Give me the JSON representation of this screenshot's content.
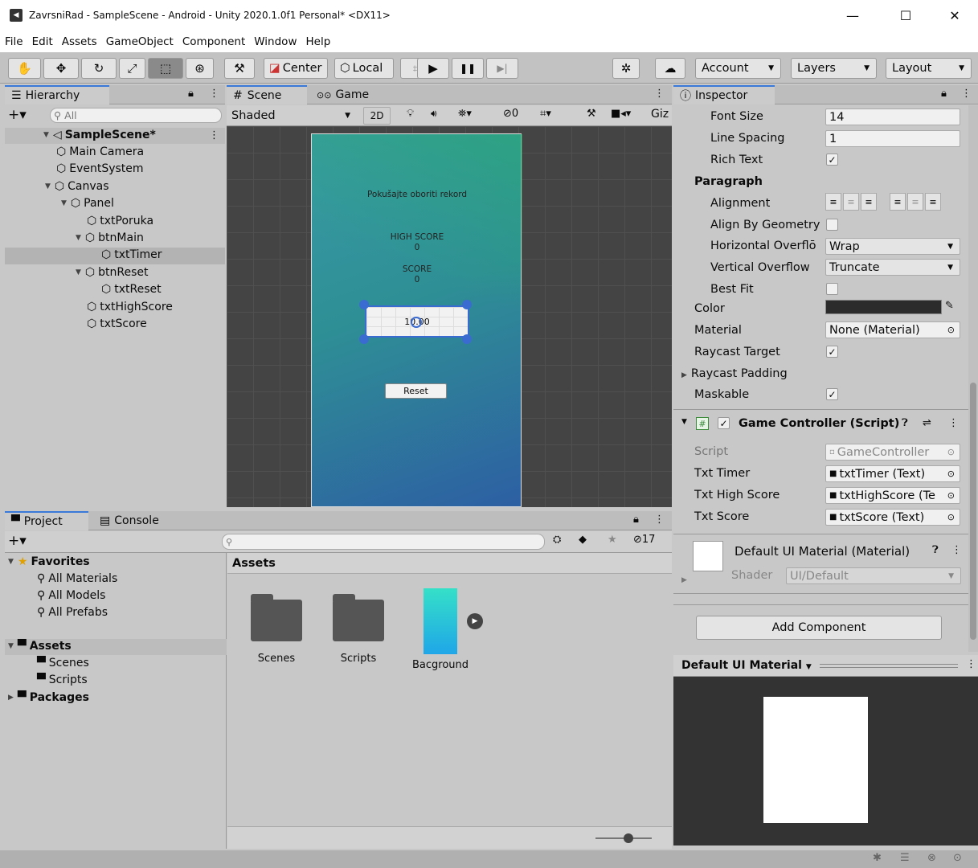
{
  "window": {
    "title": "ZavrsniRad - SampleScene - Android - Unity 2020.1.0f1 Personal* <DX11>",
    "minimize": "—",
    "maximize": "☐",
    "close": "✕"
  },
  "menu": [
    "File",
    "Edit",
    "Assets",
    "GameObject",
    "Component",
    "Window",
    "Help"
  ],
  "toolbar": {
    "center": "Center",
    "local": "Local",
    "account": "Account",
    "layers": "Layers",
    "layout": "Layout"
  },
  "hierarchy": {
    "tab": "Hierarchy",
    "search_placeholder": "All",
    "scene": "SampleScene*",
    "items": [
      {
        "label": "Main Camera",
        "level": 1,
        "expander": ""
      },
      {
        "label": "EventSystem",
        "level": 1,
        "expander": ""
      },
      {
        "label": "Canvas",
        "level": 1,
        "expander": "▼"
      },
      {
        "label": "Panel",
        "level": 2,
        "expander": "▼"
      },
      {
        "label": "txtPoruka",
        "level": 3,
        "expander": ""
      },
      {
        "label": "btnMain",
        "level": 3,
        "expander": "▼"
      },
      {
        "label": "txtTimer",
        "level": 4,
        "expander": "",
        "selected": true
      },
      {
        "label": "btnReset",
        "level": 3,
        "expander": "▼"
      },
      {
        "label": "txtReset",
        "level": 4,
        "expander": ""
      },
      {
        "label": "txtHighScore",
        "level": 3,
        "expander": ""
      },
      {
        "label": "txtScore",
        "level": 3,
        "expander": ""
      }
    ]
  },
  "scene": {
    "tab_scene": "Scene",
    "tab_game": "Game",
    "shading": "Shaded",
    "mode2d": "2D",
    "gizmos": "Giz",
    "hidden_count": "0",
    "game_text": {
      "message": "Pokušajte oboriti rekord",
      "highscore_label": "HIGH SCORE",
      "highscore_value": "0",
      "score_label": "SCORE",
      "score_value": "0",
      "timer": "10.00",
      "reset": "Reset"
    }
  },
  "inspector": {
    "tab": "Inspector",
    "text_props": [
      {
        "label": "Font Size",
        "value": "14"
      },
      {
        "label": "Line Spacing",
        "value": "1"
      }
    ],
    "rich_text": "Rich Text",
    "paragraph": "Paragraph",
    "alignment": "Alignment",
    "align_by_geometry": "Align By Geometry",
    "h_overflow": {
      "label": "Horizontal Overflō",
      "value": "Wrap"
    },
    "v_overflow": {
      "label": "Vertical Overflow",
      "value": "Truncate"
    },
    "best_fit": "Best Fit",
    "color": "Color",
    "color_value": "#2b2b2b",
    "material": "Material",
    "material_value": "None (Material)",
    "raycast_target": "Raycast Target",
    "raycast_padding": "Raycast Padding",
    "maskable": "Maskable",
    "component": {
      "title": "Game Controller (Script)",
      "script_label": "Script",
      "script_value": "GameController",
      "fields": [
        {
          "label": "Txt Timer",
          "value": "txtTimer (Text)"
        },
        {
          "label": "Txt High Score",
          "value": "txtHighScore (Te"
        },
        {
          "label": "Txt Score",
          "value": "txtScore (Text)"
        }
      ]
    },
    "material_block": {
      "title": "Default UI Material (Material)",
      "shader_label": "Shader",
      "shader_value": "UI/Default"
    },
    "add_component": "Add Component",
    "preview": {
      "title": "Default UI Material"
    }
  },
  "project": {
    "tab_project": "Project",
    "tab_console": "Console",
    "hidden_count": "17",
    "favorites": "Favorites",
    "fav_items": [
      "All Materials",
      "All Models",
      "All Prefabs"
    ],
    "assets": "Assets",
    "asset_folders": [
      "Scenes",
      "Scripts"
    ],
    "packages": "Packages",
    "breadcrumb": "Assets",
    "grid": [
      {
        "label": "Scenes",
        "kind": "folder"
      },
      {
        "label": "Scripts",
        "kind": "folder"
      },
      {
        "label": "Bacground",
        "kind": "image"
      }
    ]
  },
  "colors": {
    "accent": "#3a79d8",
    "bg_gradient_start": "#2f9a7e",
    "bg_gradient_end": "#2e5fa6"
  }
}
